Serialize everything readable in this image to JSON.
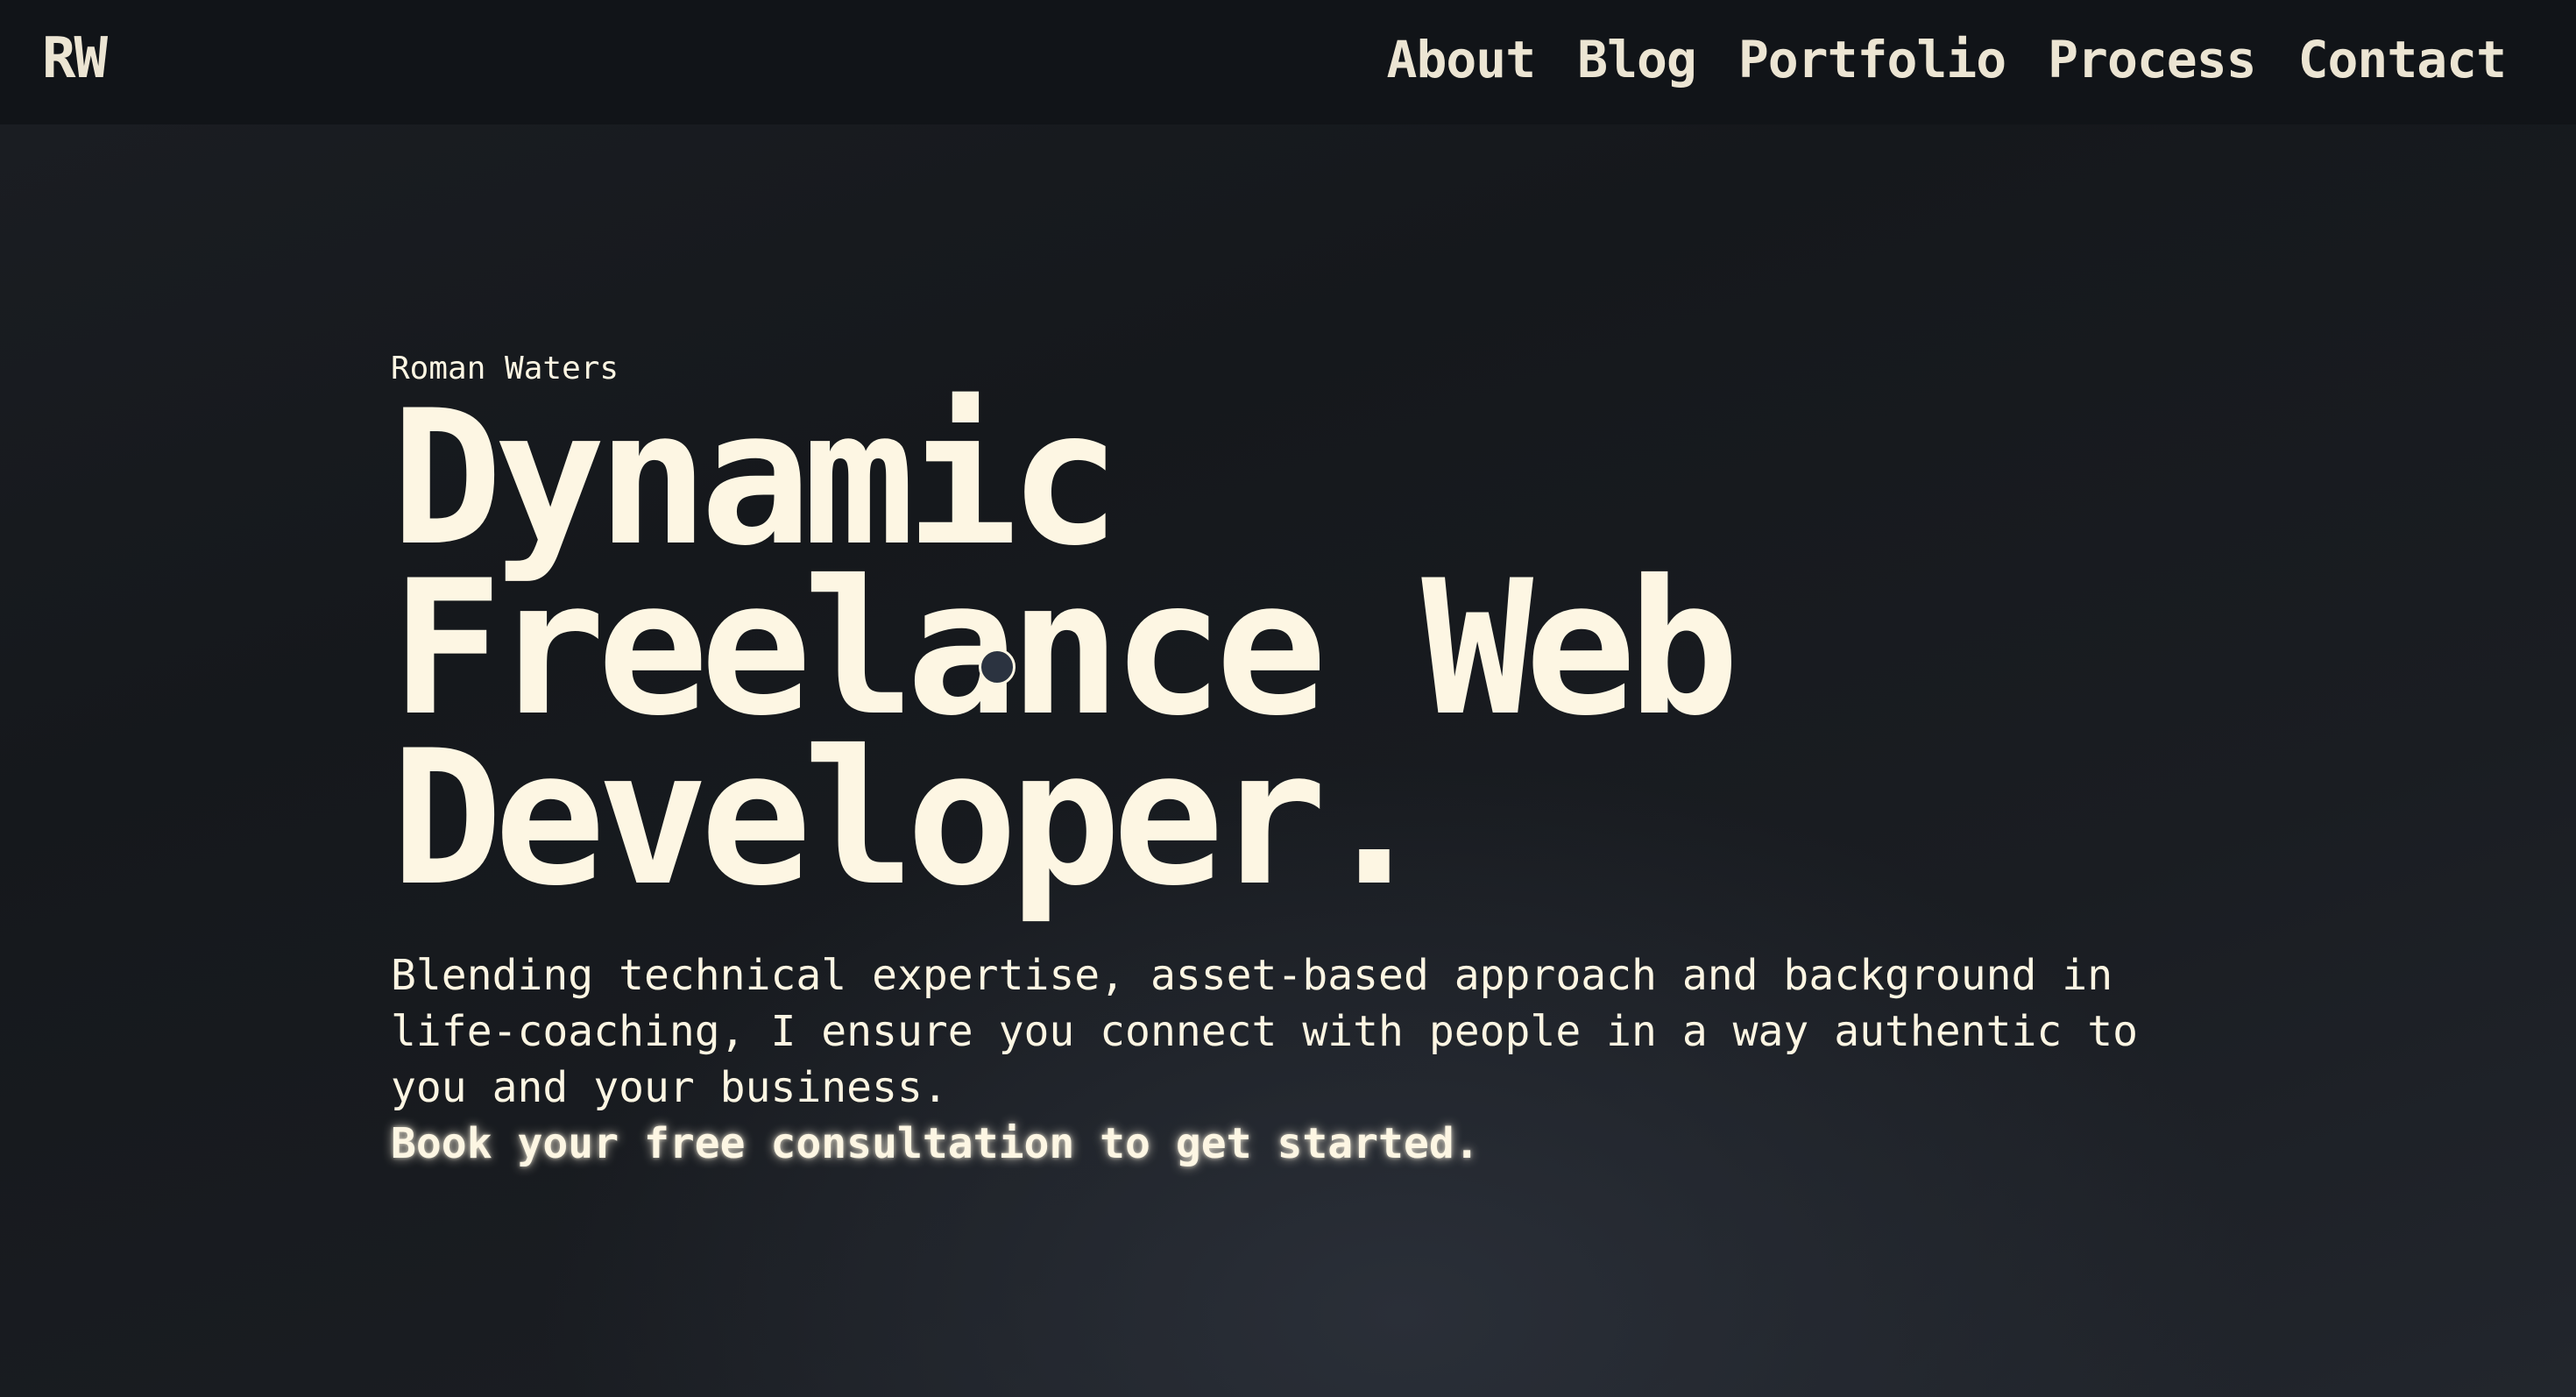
{
  "nav": {
    "logo": "RW",
    "links": [
      "About",
      "Blog",
      "Portfolio",
      "Process",
      "Contact"
    ]
  },
  "hero": {
    "eyebrow": "Roman Waters",
    "headline_lines": [
      "Dynamic",
      "Freelance Web",
      "Developer."
    ],
    "intro": "Blending technical expertise, asset-based approach and background in life-coaching, I ensure you connect with people in a way authentic to you and your business.",
    "cta": "Book your free consultation to get started."
  },
  "colors": {
    "background": "#16191d",
    "nav_background": "#111418",
    "text": "#fdf6e3",
    "nav_text": "#ece5d3"
  }
}
